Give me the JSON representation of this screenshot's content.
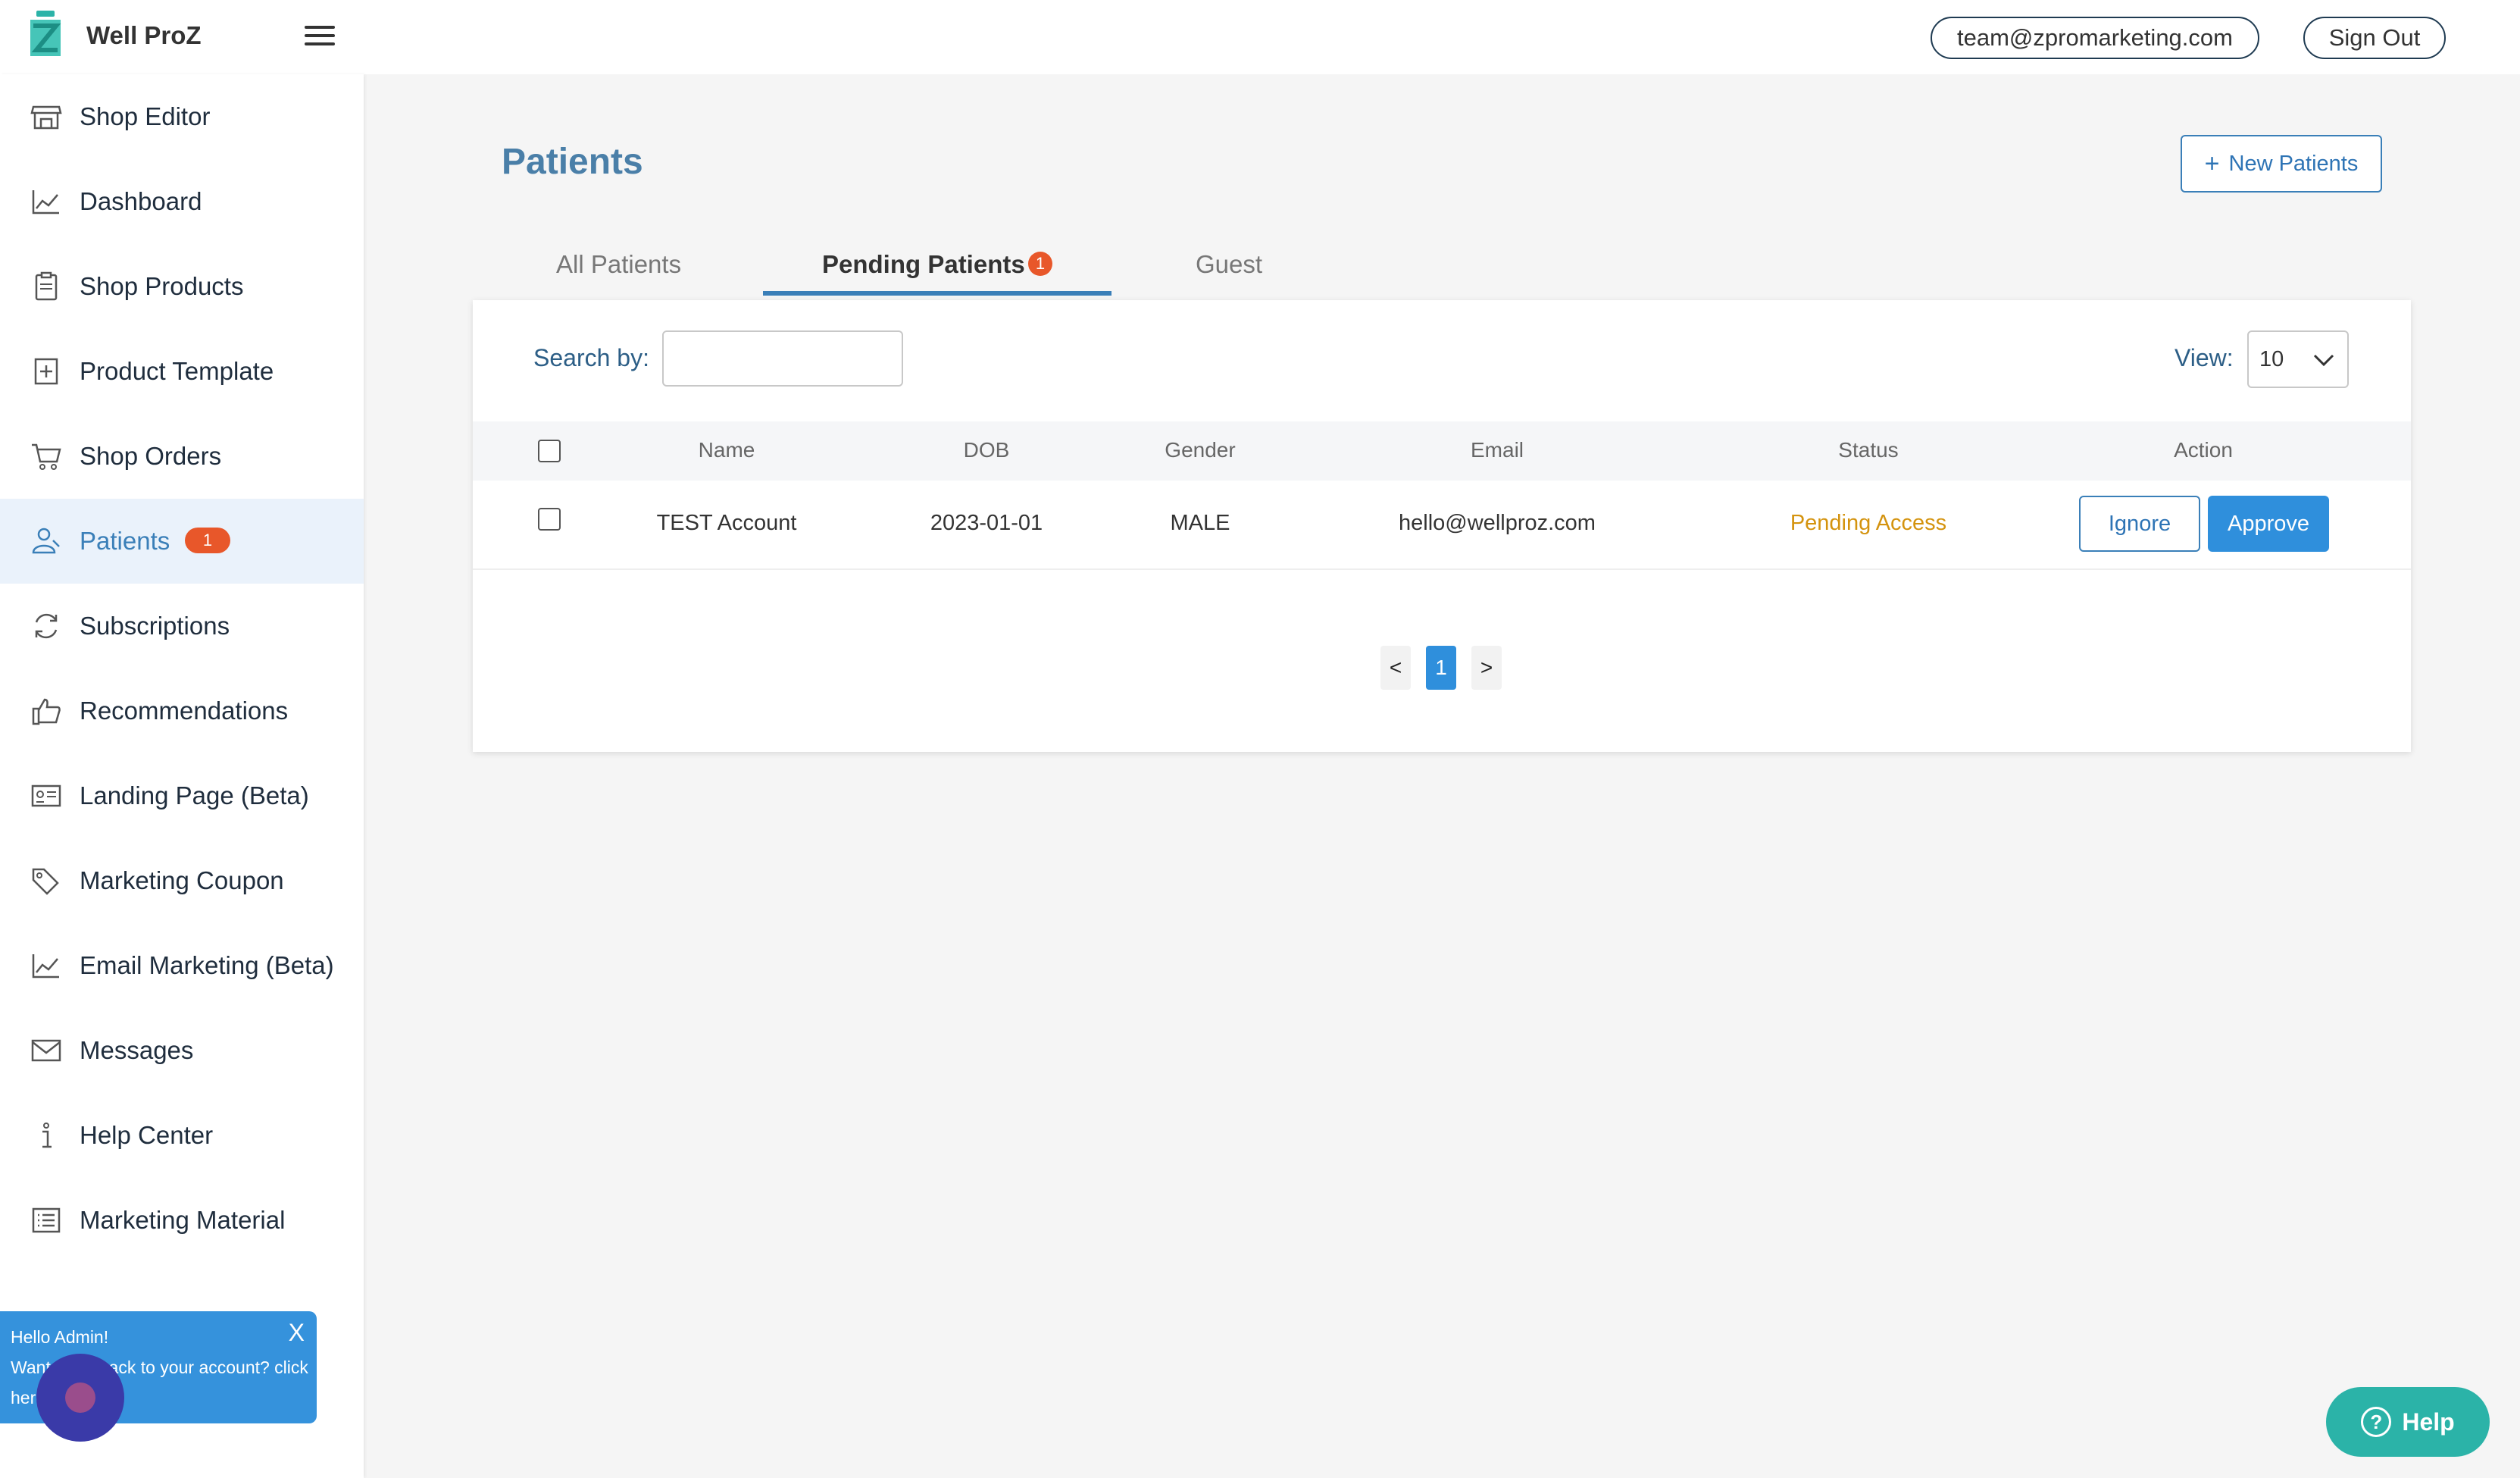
{
  "header": {
    "brand": "Well ProZ",
    "email": "team@zpromarketing.com",
    "sign_out": "Sign Out"
  },
  "sidebar": {
    "items": [
      {
        "label": "Shop Editor",
        "icon": "storefront-icon"
      },
      {
        "label": "Dashboard",
        "icon": "chart-line-icon"
      },
      {
        "label": "Shop Products",
        "icon": "clipboard-icon"
      },
      {
        "label": "Product Template",
        "icon": "add-box-icon"
      },
      {
        "label": "Shop Orders",
        "icon": "cart-icon"
      },
      {
        "label": "Patients",
        "icon": "users-icon",
        "badge": "1"
      },
      {
        "label": "Subscriptions",
        "icon": "refresh-icon"
      },
      {
        "label": "Recommendations",
        "icon": "thumbs-up-icon"
      },
      {
        "label": "Landing Page (Beta)",
        "icon": "id-card-icon"
      },
      {
        "label": "Marketing Coupon",
        "icon": "tags-icon"
      },
      {
        "label": "Email Marketing (Beta)",
        "icon": "chart-line-icon"
      },
      {
        "label": "Messages",
        "icon": "envelope-icon"
      },
      {
        "label": "Help Center",
        "icon": "info-icon"
      },
      {
        "label": "Marketing Material",
        "icon": "list-icon"
      }
    ]
  },
  "main": {
    "title": "Patients",
    "new_button": "New Patients",
    "tabs": [
      {
        "label": "All Patients"
      },
      {
        "label": "Pending Patients",
        "badge": "1"
      },
      {
        "label": "Guest"
      }
    ],
    "search_label": "Search by:",
    "search_value": "",
    "view_label": "View:",
    "view_value": "10",
    "columns": [
      "Name",
      "DOB",
      "Gender",
      "Email",
      "Status",
      "Action"
    ],
    "rows": [
      {
        "name": "TEST Account",
        "dob": "2023-01-01",
        "gender": "MALE",
        "email": "hello@wellproz.com",
        "status": "Pending Access",
        "ignore": "Ignore",
        "approve": "Approve"
      }
    ],
    "pagination": {
      "prev": "<",
      "current": "1",
      "next": ">"
    }
  },
  "chat_popup": {
    "line1": "Hello Admin!",
    "line2": "Want to go back to your account? click",
    "line3": "here",
    "close": "X"
  },
  "help_button": "Help",
  "colors": {
    "accent": "#3a7fb8",
    "badge": "#e8572a",
    "approve": "#2f8fdc",
    "pending": "#d4930e",
    "help": "#2bb3a8"
  }
}
